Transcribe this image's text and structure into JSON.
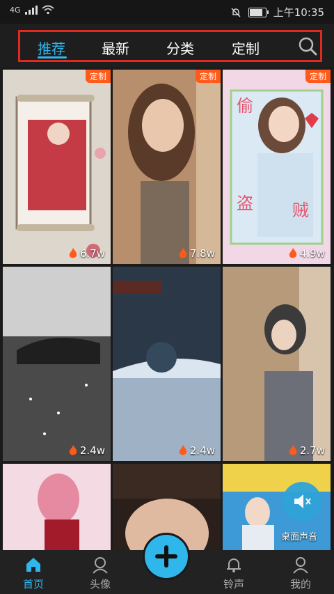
{
  "statusbar": {
    "network": "4G",
    "time": "上午10:35"
  },
  "tabs": [
    {
      "label": "推荐",
      "active": true
    },
    {
      "label": "最新"
    },
    {
      "label": "分类"
    },
    {
      "label": "定制"
    }
  ],
  "grid": [
    {
      "badge": "定制",
      "count": "6.7w",
      "colors": [
        "#dcd6cf",
        "#e9c9cc",
        "#c43b45"
      ]
    },
    {
      "badge": "定制",
      "count": "7.8w",
      "colors": [
        "#d7b08a",
        "#9a6a4e",
        "#e8cfb3"
      ]
    },
    {
      "badge": "定制",
      "count": "4.9w",
      "colors": [
        "#f2d7e6",
        "#dbe9f4",
        "#f7c6da"
      ]
    },
    {
      "badge": "",
      "count": "2.4w",
      "colors": [
        "#d0d0d0",
        "#6a6a6a",
        "#2a2a2a"
      ]
    },
    {
      "badge": "",
      "count": "2.4w",
      "colors": [
        "#2b3847",
        "#5d6f84",
        "#c9d5e2"
      ]
    },
    {
      "badge": "",
      "count": "2.7w",
      "colors": [
        "#b79a7a",
        "#7d6552",
        "#d8c4ad"
      ]
    },
    {
      "badge": "",
      "count": "",
      "colors": [
        "#f4dbe3",
        "#e59aaa",
        "#c14b5c"
      ]
    },
    {
      "badge": "",
      "count": "",
      "colors": [
        "#2a1f1b",
        "#6b4a3a",
        "#e0b9a1"
      ]
    },
    {
      "badge": "",
      "count": "",
      "colors": [
        "#3d9ad6",
        "#f0d24a",
        "#e85a8a"
      ]
    }
  ],
  "mute": {
    "label": "桌面声音"
  },
  "bottom_nav": [
    {
      "label": "首页",
      "active": true,
      "icon": "home-icon"
    },
    {
      "label": "头像",
      "icon": "avatar-icon"
    },
    {
      "label": "",
      "icon": "plus-icon"
    },
    {
      "label": "铃声",
      "icon": "bell-icon"
    },
    {
      "label": "我的",
      "icon": "user-icon"
    }
  ],
  "accent": "#2fb7ec",
  "badge_color": "#ff5a1a"
}
